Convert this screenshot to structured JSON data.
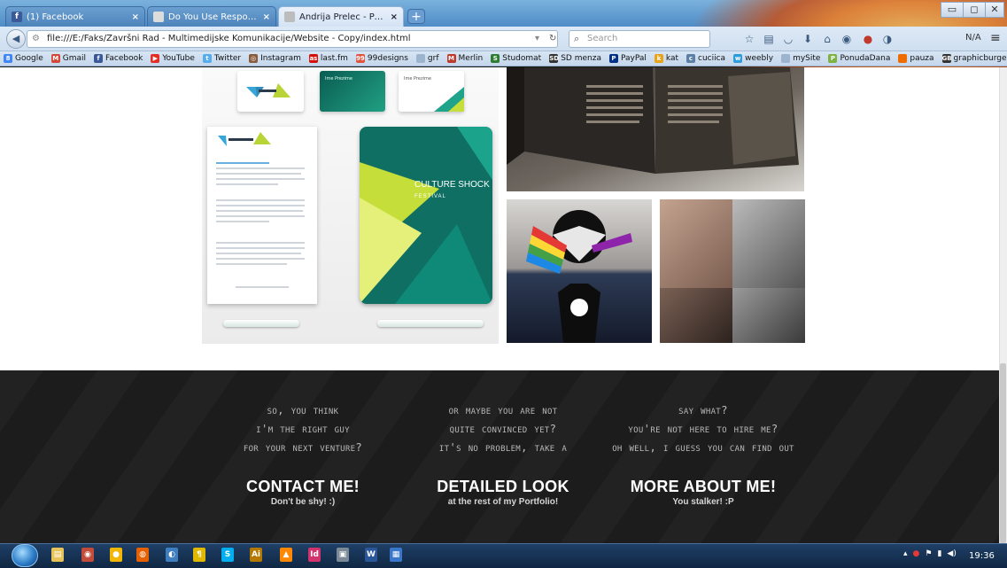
{
  "browser": {
    "tabs": [
      {
        "label": "(1) Facebook",
        "favicon": "f",
        "color": "#3b5998"
      },
      {
        "label": "Do You Use Responsive Web D...",
        "favicon": "",
        "color": "#e6e6e6"
      },
      {
        "label": "Andrija Prelec - Personal Websi...",
        "favicon": "",
        "color": "#e6e6e6"
      }
    ],
    "active_tab": 2,
    "url": "file:///E:/Faks/Završni Rad - Multimedijske Komunikacije/Website - Copy/index.html",
    "search_placeholder": "Search",
    "na_label": "N/A",
    "bookmarks": [
      {
        "label": "Google",
        "color": "#4285f4",
        "icon": "8"
      },
      {
        "label": "Gmail",
        "color": "#d44638",
        "icon": "M"
      },
      {
        "label": "Facebook",
        "color": "#3b5998",
        "icon": "f"
      },
      {
        "label": "YouTube",
        "color": "#e52d27",
        "icon": "▶"
      },
      {
        "label": "Twitter",
        "color": "#55acee",
        "icon": "t"
      },
      {
        "label": "Instagram",
        "color": "#8a5a3c",
        "icon": "◎"
      },
      {
        "label": "last.fm",
        "color": "#d51007",
        "icon": "as"
      },
      {
        "label": "99designs",
        "color": "#e0533f",
        "icon": "99"
      },
      {
        "label": "grf",
        "color": "#9db4cf",
        "icon": ""
      },
      {
        "label": "Merlin",
        "color": "#c0392b",
        "icon": "M"
      },
      {
        "label": "Studomat",
        "color": "#2e7d32",
        "icon": "S"
      },
      {
        "label": "SD menza",
        "color": "#333333",
        "icon": "SD"
      },
      {
        "label": "PayPal",
        "color": "#003087",
        "icon": "P"
      },
      {
        "label": "kat",
        "color": "#e8a317",
        "icon": "k"
      },
      {
        "label": "cuciica",
        "color": "#5b7fa6",
        "icon": "c"
      },
      {
        "label": "weebly",
        "color": "#2d9cdb",
        "icon": "w"
      },
      {
        "label": "mySite",
        "color": "#9db4cf",
        "icon": ""
      },
      {
        "label": "PonudaDana",
        "color": "#7cb342",
        "icon": "P"
      },
      {
        "label": "pauza",
        "color": "#ef6c00",
        "icon": ""
      },
      {
        "label": "graphicburger",
        "color": "#333333",
        "icon": "GB"
      }
    ]
  },
  "gallery": {
    "brand_card_text": "CULTURE SHOCK",
    "brand_card_sub": "FESTIVAL",
    "card_name": "Ime Prezime"
  },
  "footer": {
    "columns": [
      {
        "lines": [
          "So, you think",
          "I'm the right guy",
          "for your next venture?"
        ],
        "cta": "CONTACT ME!",
        "sub": "Don't be shy! :)"
      },
      {
        "lines": [
          "Or maybe you are not",
          "quite convinced yet?",
          "It's no problem, take a"
        ],
        "cta": "DETAILED LOOK",
        "sub": "at the rest of my Portfolio!"
      },
      {
        "lines": [
          "Say what?",
          "You're not here to hire me?",
          "Oh well, I guess you can find out"
        ],
        "cta": "MORE ABOUT ME!",
        "sub": "You stalker! :P"
      }
    ]
  },
  "taskbar": {
    "clock": "19:36",
    "apps": [
      {
        "name": "explorer",
        "color": "#e8c35a",
        "glyph": "▤"
      },
      {
        "name": "media",
        "color": "#c34b3a",
        "glyph": "◉"
      },
      {
        "name": "chrome",
        "color": "#f2b705",
        "glyph": "●"
      },
      {
        "name": "firefox",
        "color": "#e66000",
        "glyph": "◍"
      },
      {
        "name": "photoshop-bridge",
        "color": "#3f7fbf",
        "glyph": "◐"
      },
      {
        "name": "app-yellow",
        "color": "#e0b800",
        "glyph": "¶"
      },
      {
        "name": "skype",
        "color": "#00aff0",
        "glyph": "S"
      },
      {
        "name": "illustrator",
        "color": "#b57900",
        "glyph": "Ai"
      },
      {
        "name": "vlc",
        "color": "#ff8800",
        "glyph": "▲"
      },
      {
        "name": "indesign",
        "color": "#d2336c",
        "glyph": "Id"
      },
      {
        "name": "app-grey",
        "color": "#7c8a98",
        "glyph": "▣"
      },
      {
        "name": "word",
        "color": "#2b579a",
        "glyph": "W"
      },
      {
        "name": "app-blue",
        "color": "#3a77c8",
        "glyph": "▦"
      }
    ]
  }
}
